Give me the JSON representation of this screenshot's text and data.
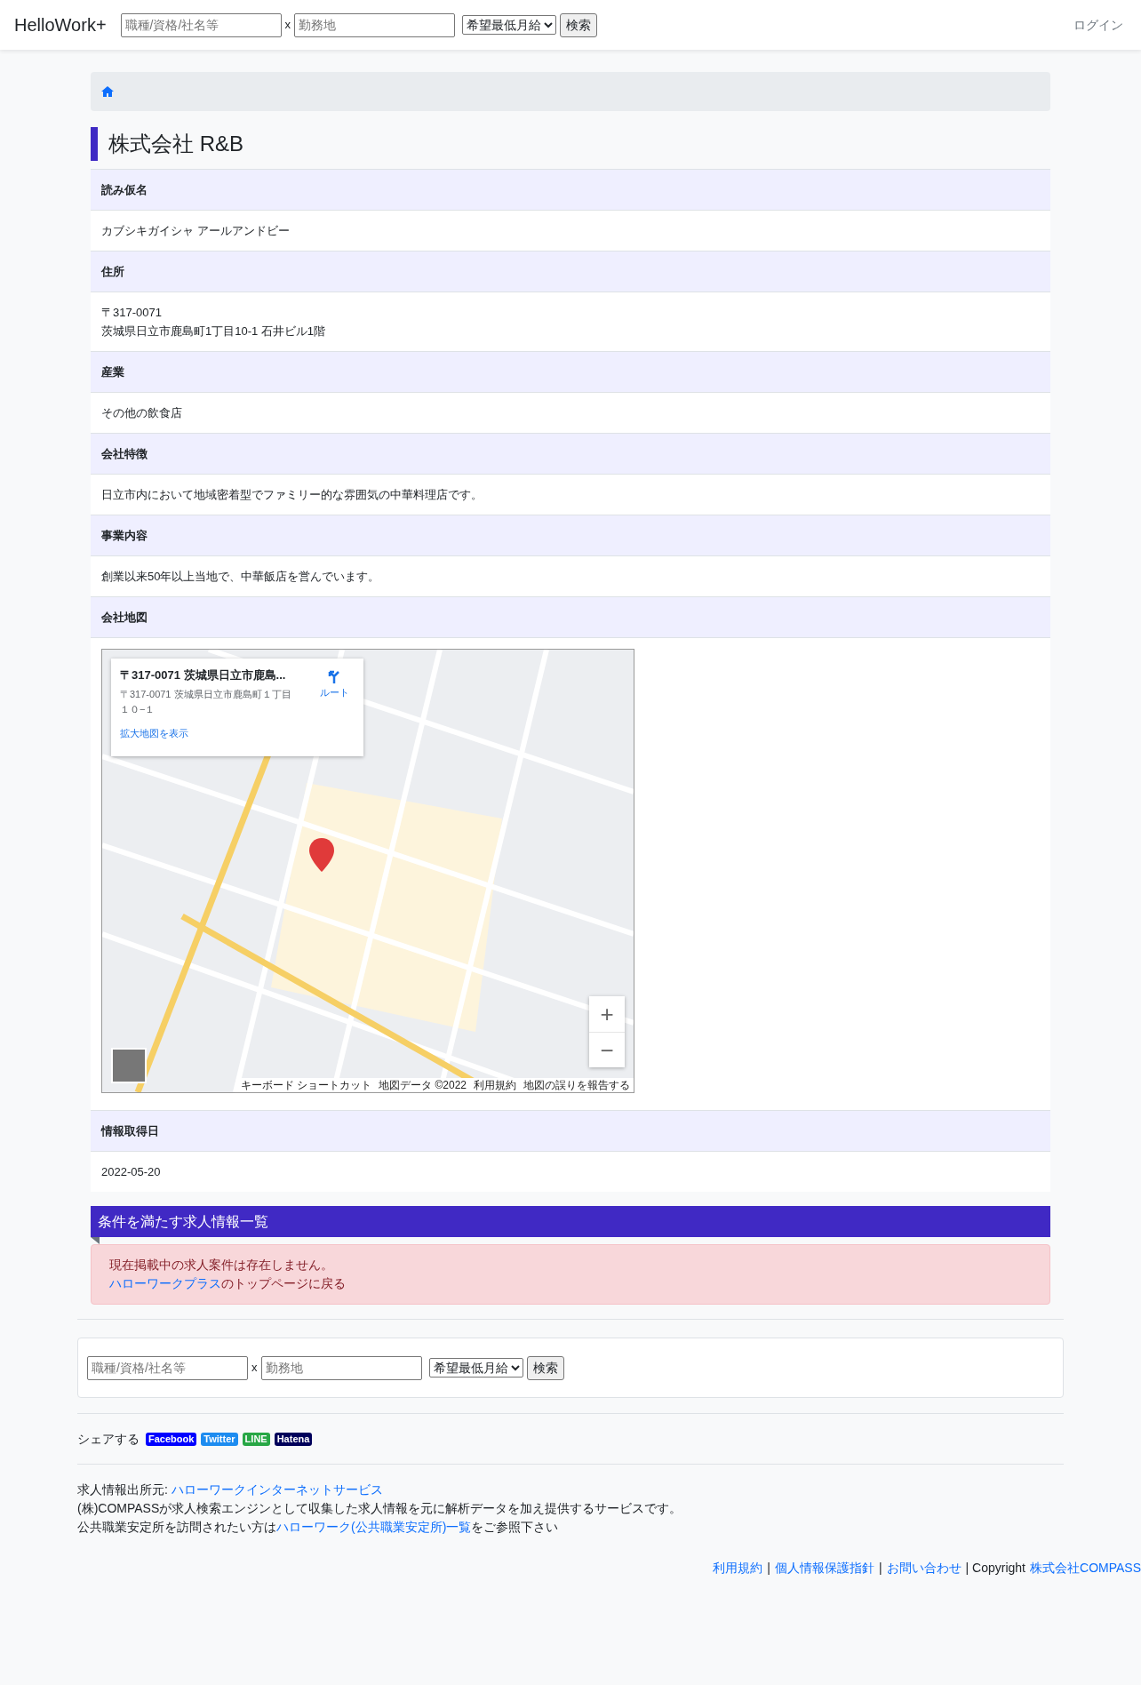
{
  "header": {
    "brand": "HelloWork+",
    "keyword_placeholder": "職種/資格/社名等",
    "separator": "x",
    "location_placeholder": "勤務地",
    "salary_select": "希望最低月給",
    "search_button": "検索",
    "login": "ログイン"
  },
  "company": {
    "name": "株式会社 R&B"
  },
  "details": [
    {
      "kind": "text",
      "label": "読み仮名",
      "lines": [
        "カブシキガイシャ アールアンドビー"
      ]
    },
    {
      "kind": "text",
      "label": "住所",
      "lines": [
        "〒317-0071",
        "茨城県日立市鹿島町1丁目10-1 石井ビル1階"
      ]
    },
    {
      "kind": "text",
      "label": "産業",
      "lines": [
        "その他の飲食店"
      ]
    },
    {
      "kind": "text",
      "label": "会社特徴",
      "lines": [
        "日立市内において地域密着型でファミリー的な雰囲気の中華料理店です。"
      ]
    },
    {
      "kind": "text",
      "label": "事業内容",
      "lines": [
        "創業以来50年以上当地で、中華飯店を営んでいます。"
      ]
    },
    {
      "kind": "map",
      "label": "会社地図",
      "map": {
        "card_title": "〒317-0071 茨城県日立市鹿島...",
        "card_address": "〒317-0071 茨城県日立市鹿島町１丁目１０−１",
        "route": "ルート",
        "larger_map_link": "拡大地図を表示",
        "zoom_in": "+",
        "zoom_out": "−",
        "attribution": [
          "キーボード ショートカット",
          "地図データ ©2022",
          "利用規約",
          "地図の誤りを報告する"
        ]
      }
    },
    {
      "kind": "text",
      "label": "情報取得日",
      "lines": [
        "2022-05-20"
      ]
    }
  ],
  "jobs": {
    "heading": "条件を満たす求人情報一覧",
    "message": "現在掲載中の求人案件は存在しません。",
    "link": "ハローワークプラス",
    "link_suffix": "のトップページに戻る"
  },
  "bottom_search": {
    "keyword_placeholder": "職種/資格/社名等",
    "separator": "x",
    "location_placeholder": "勤務地",
    "salary_select": "希望最低月給",
    "search_button": "検索"
  },
  "share": {
    "label": "シェアする",
    "buttons": [
      {
        "label": "Facebook",
        "color": "#0000ff"
      },
      {
        "label": "Twitter",
        "color": "#1d8cf0"
      },
      {
        "label": "LINE",
        "color": "#28a745"
      },
      {
        "label": "Hatena",
        "color": "#00005a"
      }
    ]
  },
  "source_lines": [
    {
      "prefix": "求人情報出所元: ",
      "link": "ハローワークインターネットサービス"
    },
    {
      "prefix": "(株)COMPASSが求人検索エンジンとして収集した求人情報を元に解析データを加え提供するサービスです。"
    },
    {
      "prefix": "公共職業安定所を訪問されたい方は",
      "link": "ハローワーク(公共職業安定所)一覧",
      "suffix": "をご参照下さい"
    }
  ],
  "footer": [
    {
      "kind": "link",
      "text": "利用規約"
    },
    {
      "kind": "text",
      "text": "|"
    },
    {
      "kind": "link",
      "text": "個人情報保護指針"
    },
    {
      "kind": "text",
      "text": "|"
    },
    {
      "kind": "link",
      "text": "お問い合わせ"
    },
    {
      "kind": "text",
      "text": "| Copyright"
    },
    {
      "kind": "link",
      "text": "株式会社COMPASS"
    }
  ]
}
